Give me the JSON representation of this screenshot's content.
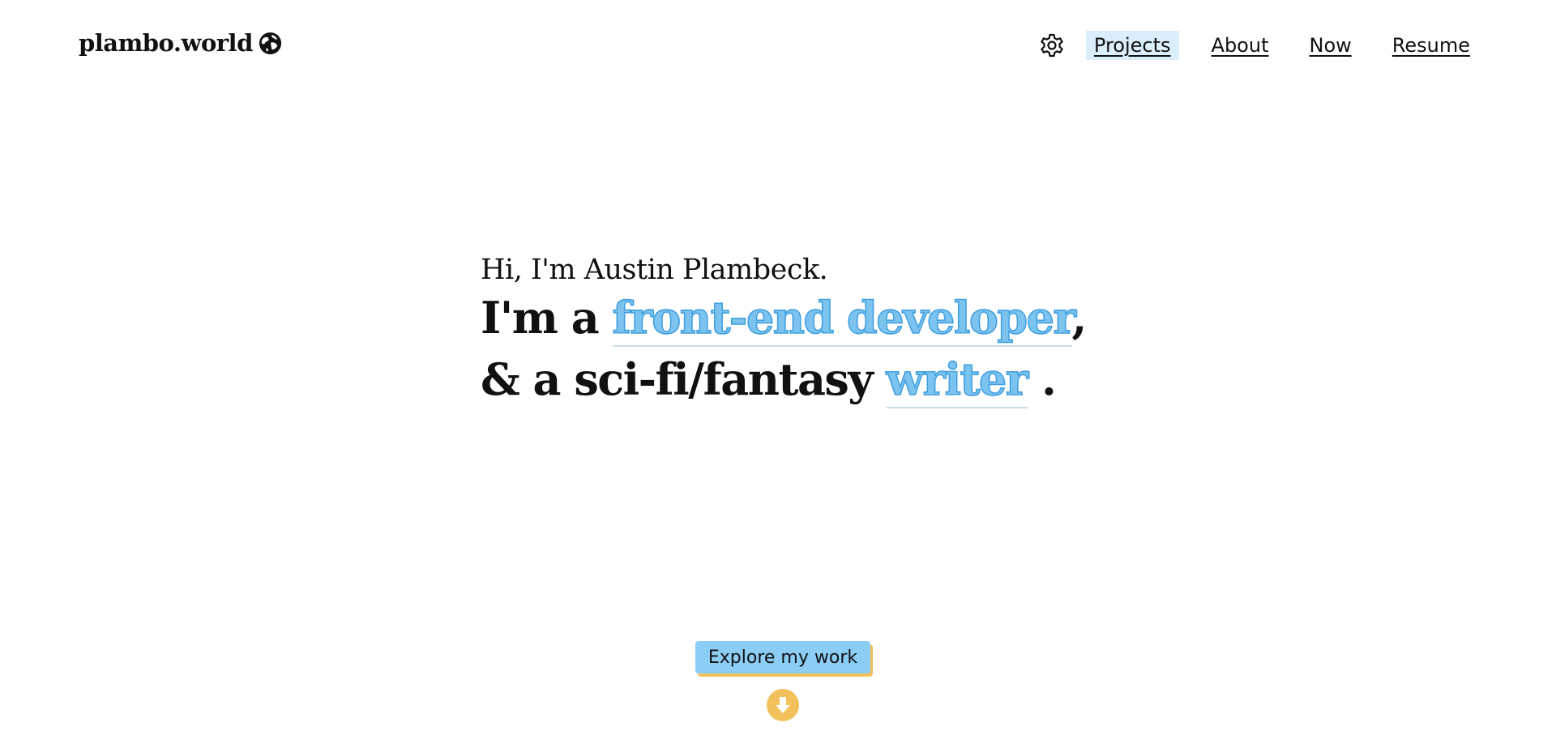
{
  "site": {
    "brand": "plambo.world",
    "brand_icon": "globe-icon"
  },
  "nav": {
    "settings_icon": "gear-icon",
    "items": [
      {
        "label": "Projects",
        "active": true
      },
      {
        "label": "About",
        "active": false
      },
      {
        "label": "Now",
        "active": false
      },
      {
        "label": "Resume",
        "active": false
      }
    ]
  },
  "hero": {
    "intro": "Hi, I'm Austin Plambeck.",
    "line1_prefix": "I'm a ",
    "line1_highlight": "front-end developer",
    "line1_suffix": ",",
    "line2_prefix": "& a sci-fi/fantasy ",
    "line2_highlight": "writer",
    "line2_suffix": " ."
  },
  "cta": {
    "label": "Explore my work",
    "icon": "arrow-down-circle-icon"
  },
  "colors": {
    "highlight_fill": "#7cc3ef",
    "highlight_stroke": "#3d9ee0",
    "active_nav_bg": "#dbeefc",
    "cta_bg": "#8ccdf5",
    "cta_shadow": "#f2c15c",
    "down_icon": "#f2c15c"
  }
}
